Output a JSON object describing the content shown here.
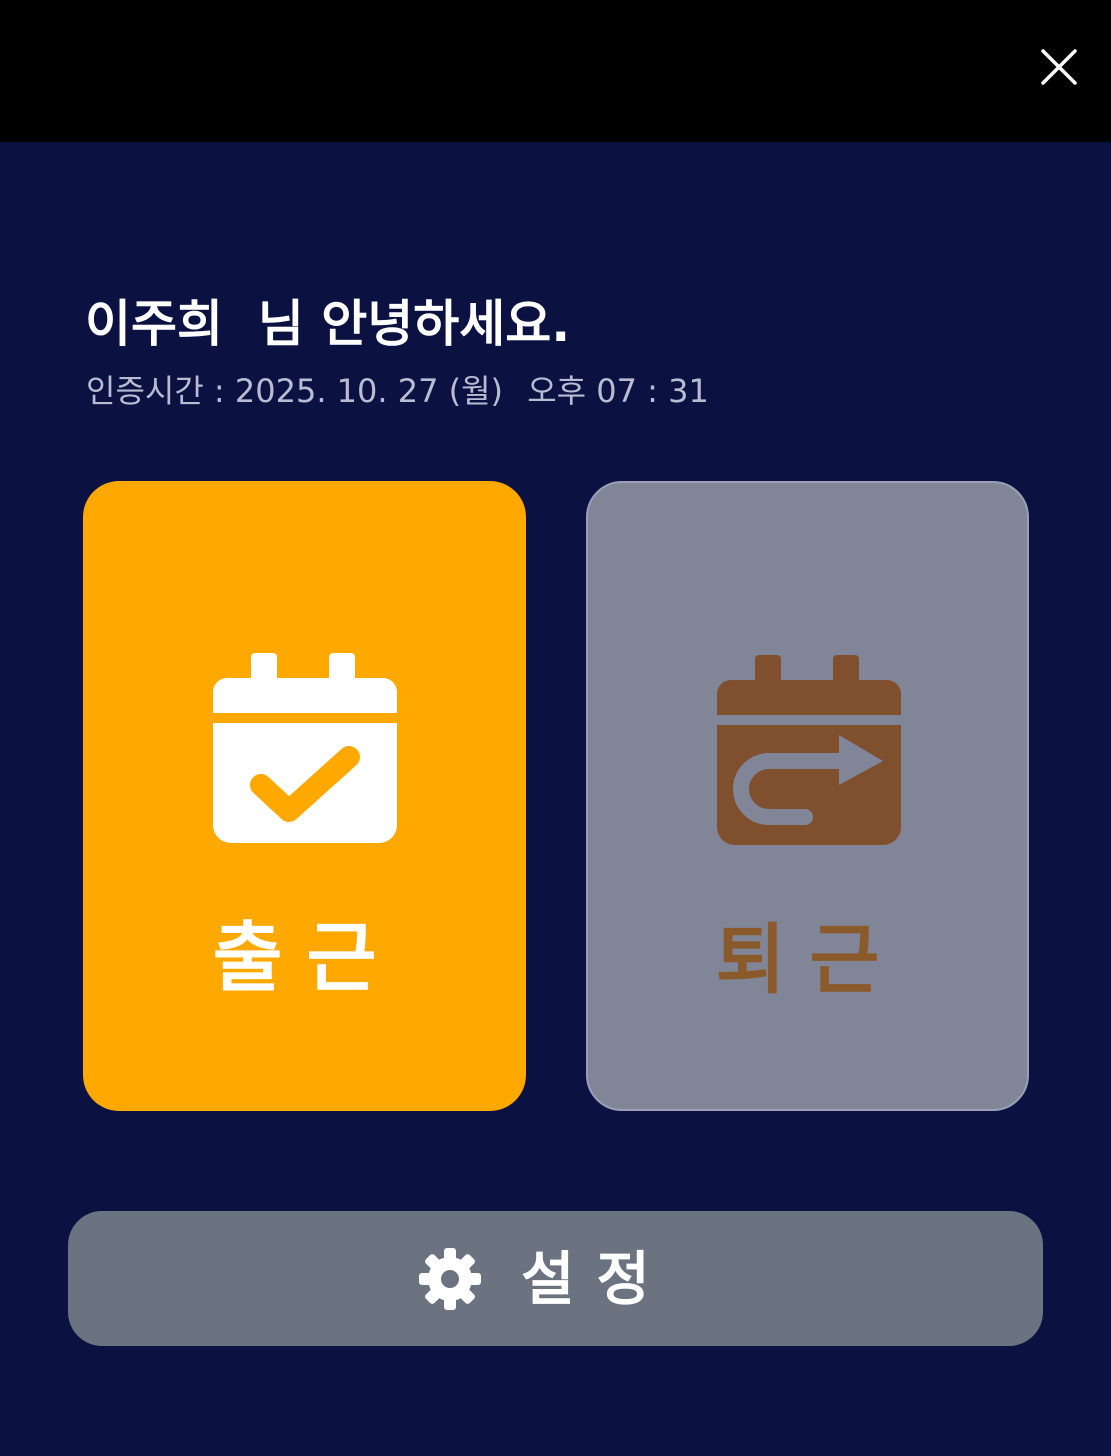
{
  "header": {
    "close_icon": "close-icon"
  },
  "greeting": {
    "text": "이주희  님 안녕하세요."
  },
  "auth": {
    "label": "인증시간 :",
    "date": "2025. 10. 27 (월)",
    "time": "오후 07 : 31"
  },
  "actions": {
    "check_in": {
      "label": "출근",
      "icon": "calendar-check-icon",
      "bg_color": "#ffa800",
      "fg_color": "#ffffff",
      "active": true
    },
    "check_out": {
      "label": "퇴근",
      "icon": "calendar-return-icon",
      "bg_color": "#808597",
      "fg_color": "#8b5a2b",
      "active": false
    }
  },
  "settings": {
    "label": "설정",
    "icon": "gear-icon",
    "bg_color": "#6b7280"
  },
  "colors": {
    "background": "#0b1242",
    "topbar": "#000000"
  }
}
